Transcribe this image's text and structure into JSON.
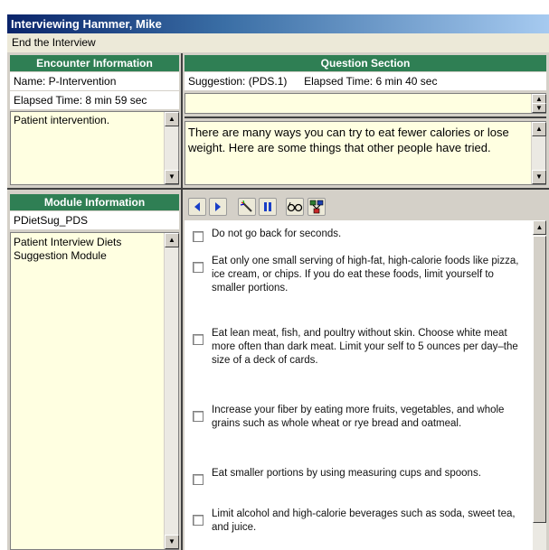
{
  "window": {
    "title": "Interviewing Hammer, Mike"
  },
  "menu": {
    "end_interview": "End the Interview"
  },
  "encounter": {
    "header": "Encounter Information",
    "name": "Name: P-Intervention",
    "elapsed": "Elapsed Time: 8 min 59 sec",
    "notes_value": "Patient intervention."
  },
  "question": {
    "header": "Question Section",
    "suggestion": "Suggestion: (PDS.1)",
    "elapsed": "Elapsed Time: 6 min 40 sec",
    "prompt": "There are many ways you can try to eat fewer calories or lose weight. Here are some things that other people have tried."
  },
  "module": {
    "header": "Module Information",
    "id": "PDietSug_PDS",
    "description": "Patient Interview Diets Suggestion Module"
  },
  "toolbar": {
    "icons": [
      "back-arrow-icon",
      "forward-arrow-icon",
      "magic-wand-icon",
      "pause-icon",
      "glasses-icon",
      "flowchart-icon"
    ]
  },
  "options": [
    {
      "label": "Do not go back for seconds.",
      "checked": false
    },
    {
      "label": "Eat only one small serving of high-fat, high-calorie foods like pizza, ice cream, or chips. If you do eat these foods, limit yourself to smaller portions.",
      "checked": false
    },
    {
      "label": "Eat lean meat, fish, and poultry without skin. Choose white meat more often than dark meat. Limit your self to 5 ounces per day–the size of a deck of cards.",
      "checked": false
    },
    {
      "label": "Increase your fiber by eating more fruits, vegetables, and whole grains such as whole wheat or rye bread and oatmeal.",
      "checked": false
    },
    {
      "label": "Eat smaller portions by using measuring cups and spoons.",
      "checked": false
    },
    {
      "label": "Limit alcohol and high-calorie beverages such as soda, sweet tea, and juice.",
      "checked": false
    }
  ],
  "colors": {
    "header_green": "#2f7f54",
    "note_yellow": "#ffffe1",
    "title_blue": "#0a246a"
  }
}
